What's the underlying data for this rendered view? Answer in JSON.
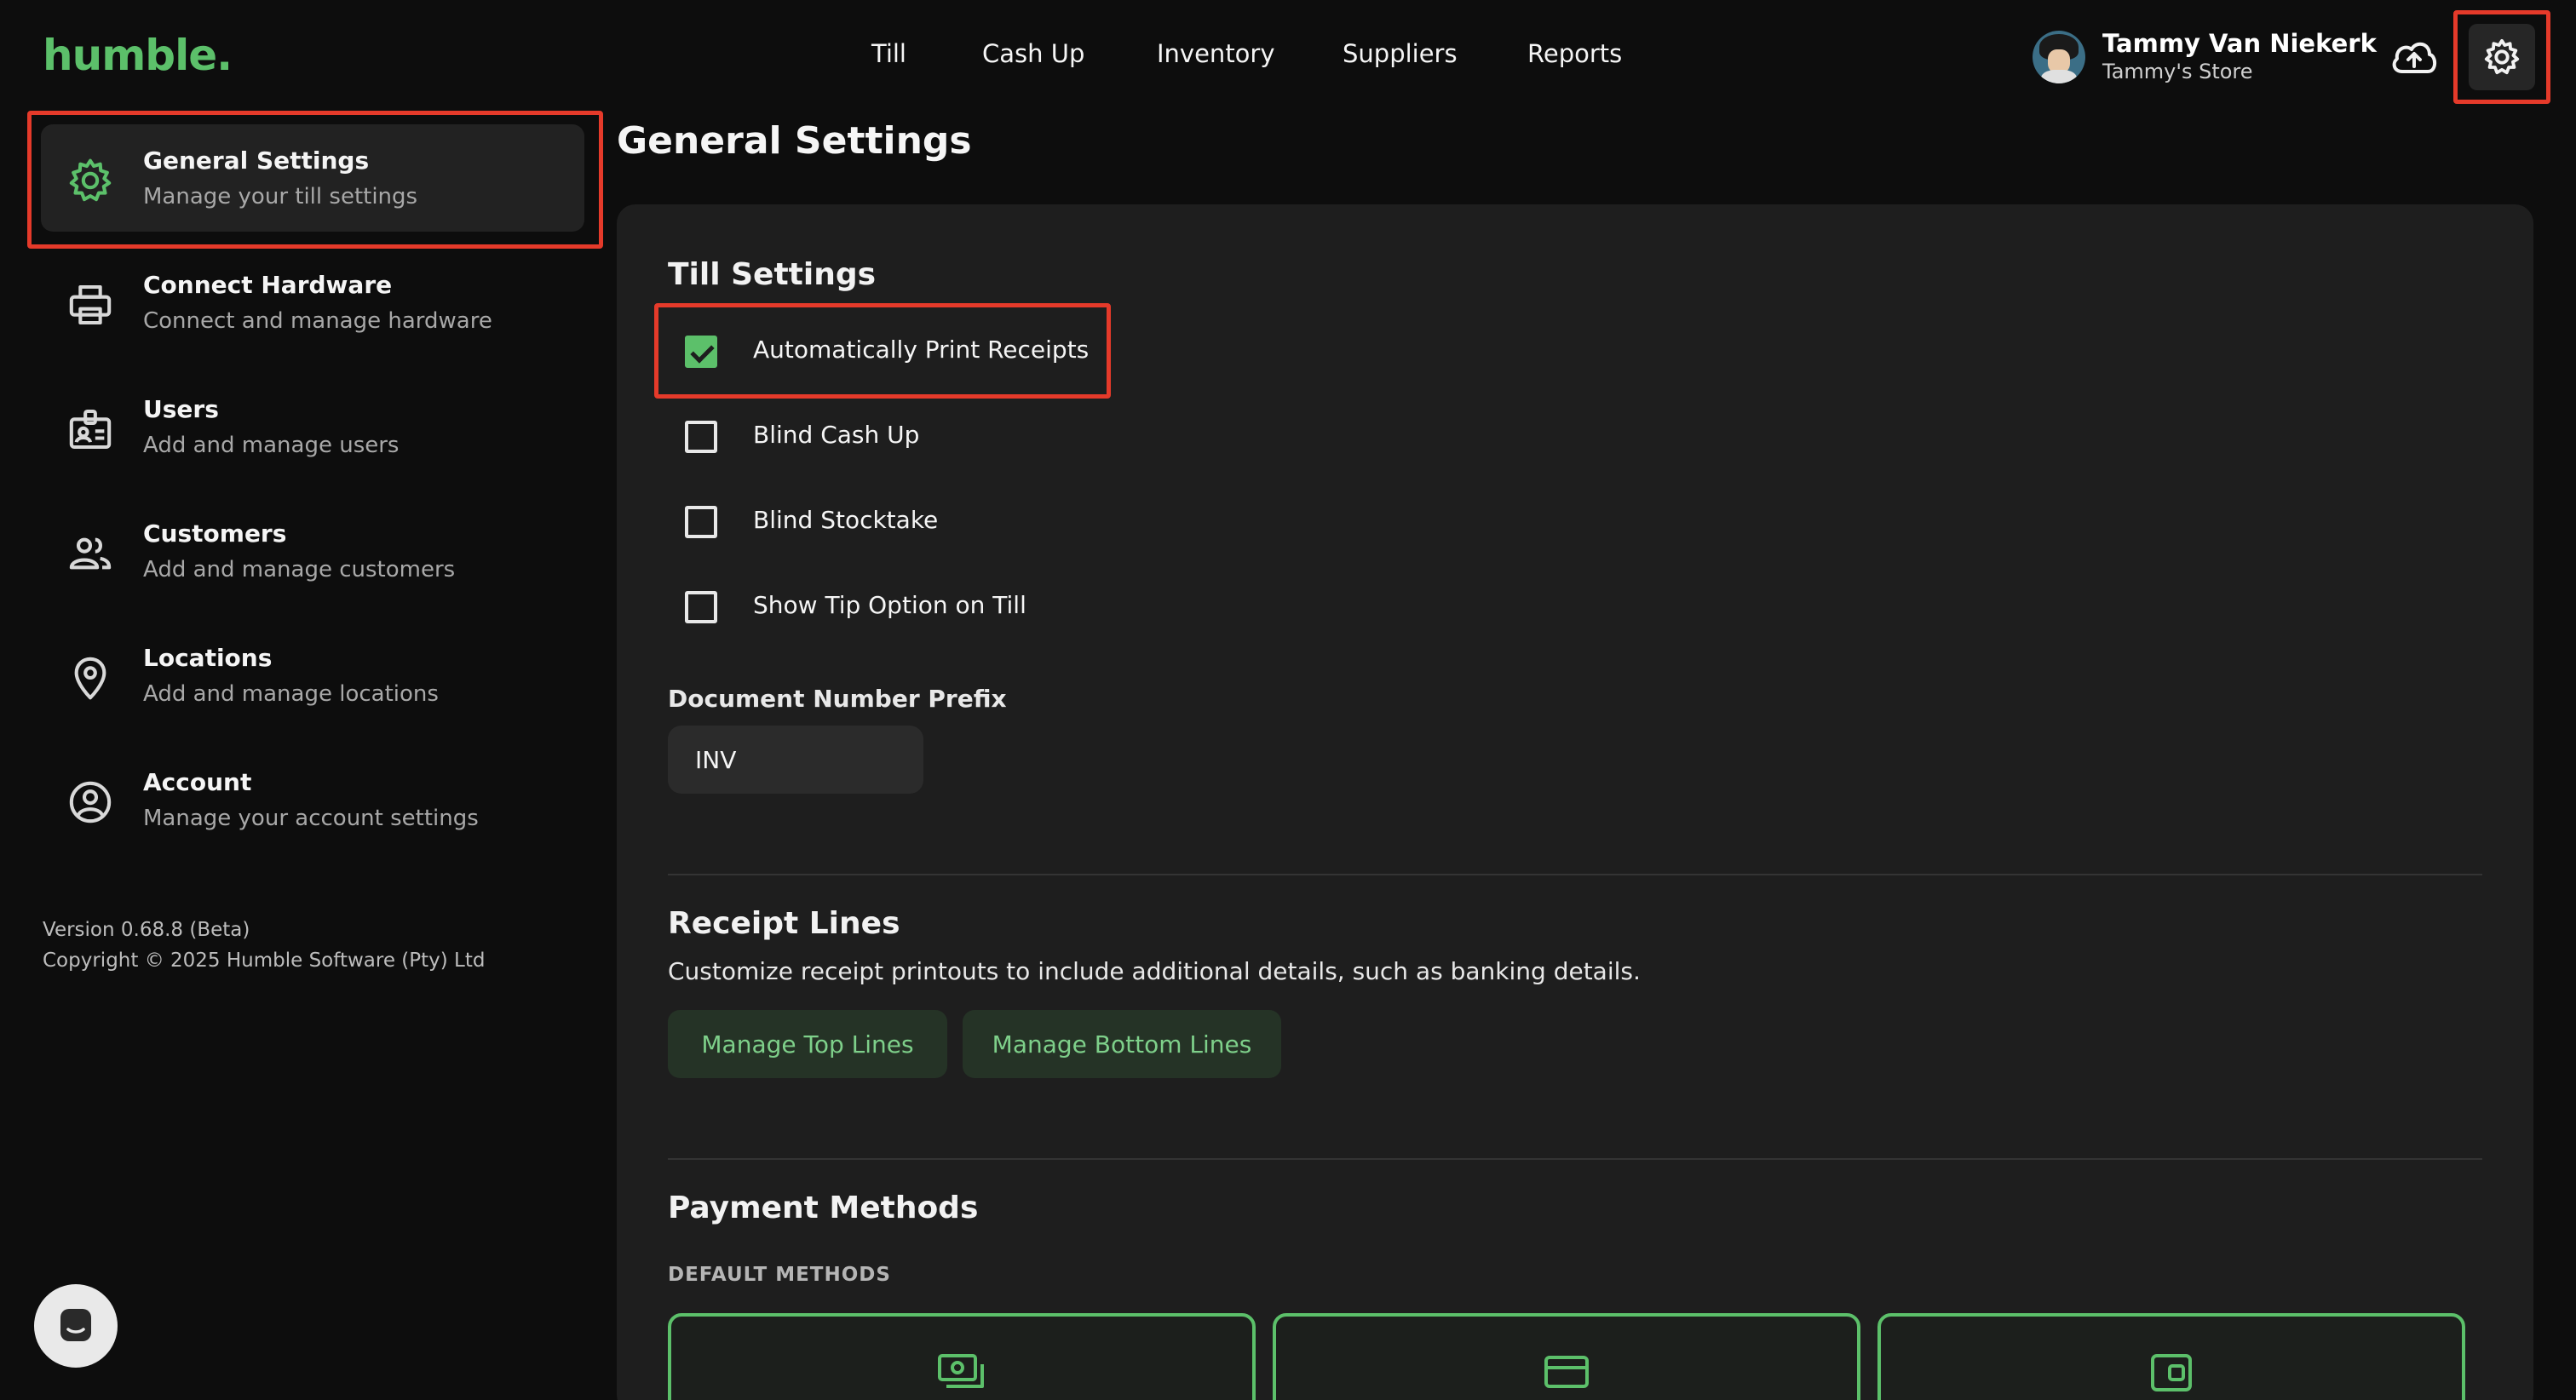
{
  "header": {
    "logo": "humble.",
    "nav": [
      "Till",
      "Cash Up",
      "Inventory",
      "Suppliers",
      "Reports"
    ],
    "user_name": "Tammy Van Niekerk",
    "store_name": "Tammy's Store"
  },
  "sidebar": {
    "items": [
      {
        "title": "General Settings",
        "subtitle": "Manage your till settings",
        "icon": "gear-icon"
      },
      {
        "title": "Connect Hardware",
        "subtitle": "Connect and manage hardware",
        "icon": "printer-icon"
      },
      {
        "title": "Users",
        "subtitle": "Add and manage users",
        "icon": "id-badge-icon"
      },
      {
        "title": "Customers",
        "subtitle": "Add and manage customers",
        "icon": "people-icon"
      },
      {
        "title": "Locations",
        "subtitle": "Add and manage locations",
        "icon": "location-pin-icon"
      },
      {
        "title": "Account",
        "subtitle": "Manage your account settings",
        "icon": "account-circle-icon"
      }
    ],
    "version": "Version 0.68.8 (Beta)",
    "copyright": "Copyright © 2025 Humble Software (Pty) Ltd"
  },
  "main": {
    "page_title": "General Settings",
    "till_settings": {
      "title": "Till Settings",
      "options": [
        {
          "label": "Automatically Print Receipts",
          "checked": true
        },
        {
          "label": "Blind Cash Up",
          "checked": false
        },
        {
          "label": "Blind Stocktake",
          "checked": false
        },
        {
          "label": "Show Tip Option on Till",
          "checked": false
        }
      ],
      "prefix_label": "Document Number Prefix",
      "prefix_value": "INV"
    },
    "receipt_lines": {
      "title": "Receipt Lines",
      "description": "Customize receipt printouts to include additional details, such as banking details.",
      "top_button": "Manage Top Lines",
      "bottom_button": "Manage Bottom Lines"
    },
    "payment_methods": {
      "title": "Payment Methods",
      "subheading": "DEFAULT METHODS",
      "cards": [
        "cash-icon",
        "card-icon",
        "wallet-icon"
      ]
    }
  },
  "colors": {
    "accent": "#5cc06a",
    "highlight": "#e53a2a",
    "background": "#0d0d0d",
    "panel": "#1e1e1e"
  }
}
